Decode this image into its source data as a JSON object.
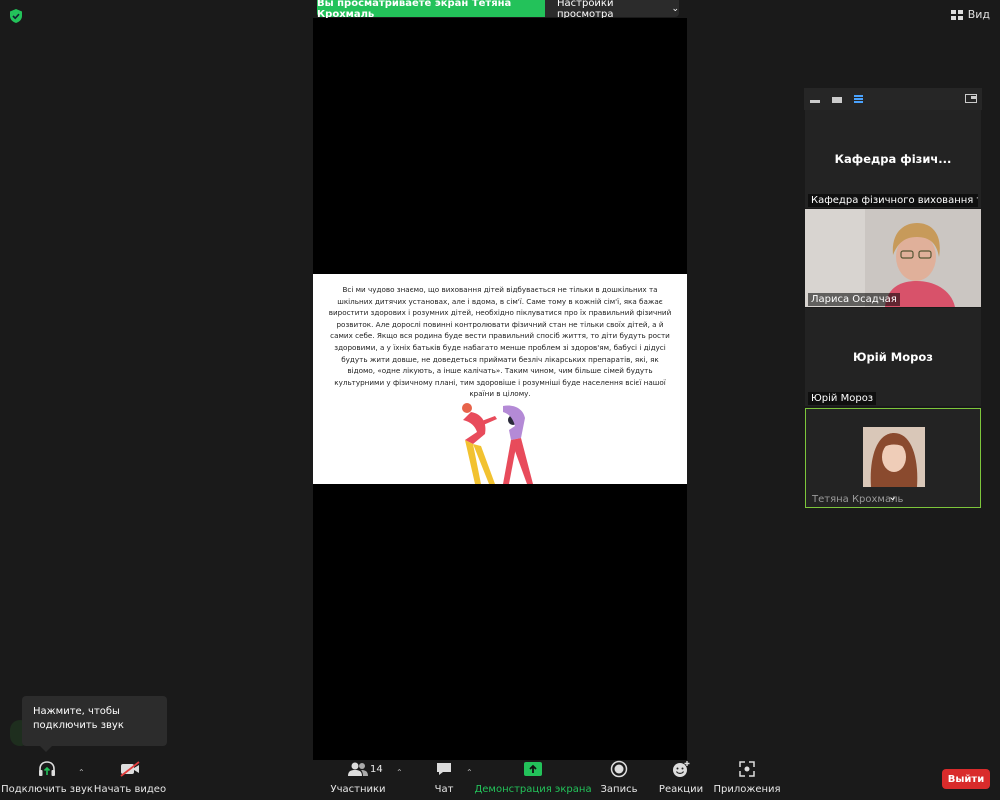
{
  "banner": {
    "viewing_text": "Вы просматриваете экран Тетяна Крохмаль",
    "view_settings_label": "Настройки просмотра"
  },
  "top_right": {
    "view_label": "Вид"
  },
  "slide": {
    "text": "Всі ми чудово знаємо, що виховання дітей відбувається не тільки в дошкільних та шкільних дитячих установах, але і вдома, в сім'ї. Саме тому в кожній сім'ї, яка бажає виростити здорових і розумних дітей, необхідно піклуватися про їх правильний фізичний розвиток. Але дорослі повинні контролювати фізичний стан не тільки своїх дітей, а й самих себе. Якщо вся родина буде вести правильний спосіб життя, то діти будуть рости здоровими, а у їхніх батьків буде набагато менше проблем зі здоров'ям, бабусі і дідусі будуть жити довше, не доведеться приймати безліч лікарських препаратів, які, як відомо, «одне лікують, а інше калічать». Таким чином, чим більше сімей будуть культурними у фізичному плані, тим здоровіше і розумніші буде населення всієї нашої країни в цілому."
  },
  "participants_panel": {
    "tiles": [
      {
        "center_name": "Кафедра  фізич...",
        "label": "Кафедра фізичного виховання та ..."
      },
      {
        "label": "Лариса Осадчая"
      },
      {
        "center_name": "Юрій Мороз",
        "label": "Юрій Мороз"
      },
      {
        "label": "Тетяна Крохмаль"
      }
    ]
  },
  "toast": {
    "text": "Нажмите, чтобы подключить звук"
  },
  "toolbar": {
    "audio_label": "Подключить звук",
    "video_label": "Начать видео",
    "participants_label": "Участники",
    "participants_count": "14",
    "chat_label": "Чат",
    "share_label": "Демонстрация экрана",
    "record_label": "Запись",
    "reactions_label": "Реакции",
    "apps_label": "Приложения",
    "leave_label": "Выйти"
  },
  "colors": {
    "share_green": "#23c25a",
    "leave_red": "#d92b2b",
    "active_speaker": "#7dc63b"
  }
}
